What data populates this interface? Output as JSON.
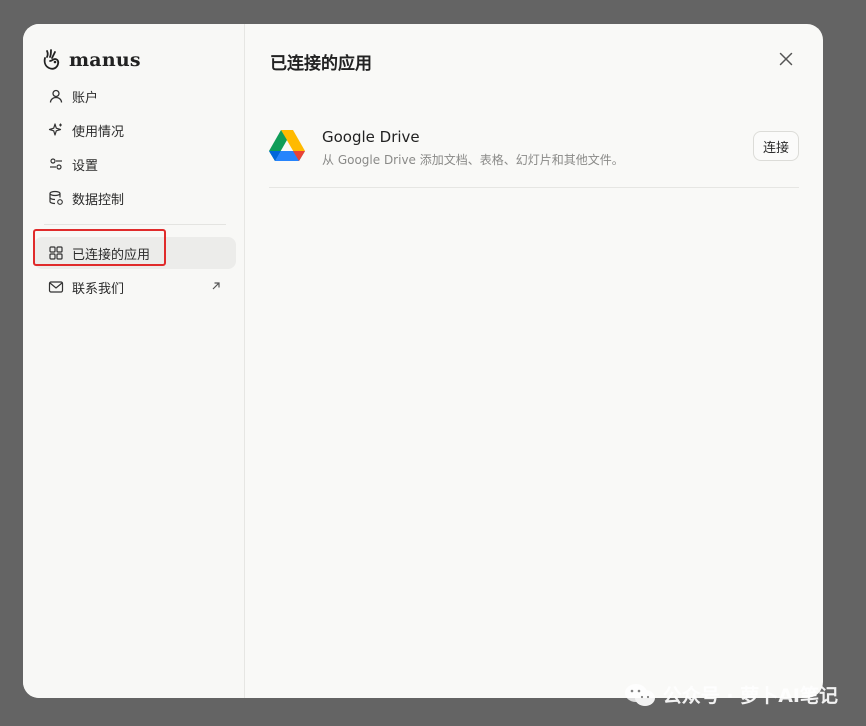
{
  "brand": {
    "name": "manus"
  },
  "sidebar": {
    "items": [
      {
        "label": "账户",
        "icon": "user-icon"
      },
      {
        "label": "使用情况",
        "icon": "sparkle-icon"
      },
      {
        "label": "设置",
        "icon": "sliders-icon"
      },
      {
        "label": "数据控制",
        "icon": "database-icon"
      }
    ],
    "secondary": [
      {
        "label": "已连接的应用",
        "icon": "grid-icon",
        "active": true
      },
      {
        "label": "联系我们",
        "icon": "mail-icon",
        "external": true
      }
    ]
  },
  "main": {
    "title": "已连接的应用",
    "apps": [
      {
        "name": "Google Drive",
        "description": "从 Google Drive 添加文档、表格、幻灯片和其他文件。",
        "action_label": "连接"
      }
    ]
  },
  "watermark": {
    "text": "公众号 · 萝卜AI笔记"
  },
  "colors": {
    "highlight": "#e02b2b",
    "backdrop": "#646464",
    "panel": "#f9f9f7"
  }
}
